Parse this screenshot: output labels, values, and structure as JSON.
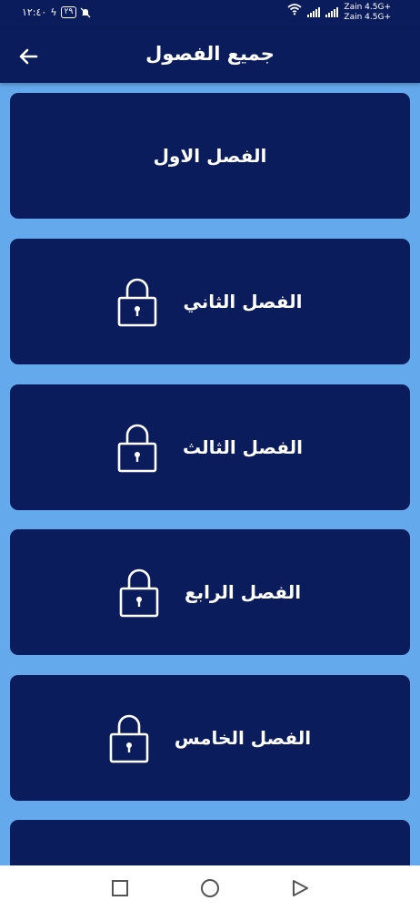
{
  "status_bar": {
    "time": "١٢:٤٠",
    "battery": "٢٩",
    "carrier_1": "Zain 4.5G+",
    "carrier_2": "Zain 4.5G+"
  },
  "app_bar": {
    "title": "جميع الفصول",
    "back_icon": "arrow-left-icon"
  },
  "chapters": [
    {
      "label": "الفصل الاول",
      "locked": false
    },
    {
      "label": "الفصل الثاني",
      "locked": true
    },
    {
      "label": "الفصل الثالث",
      "locked": true
    },
    {
      "label": "الفصل الرابع",
      "locked": true
    },
    {
      "label": "الفصل الخامس",
      "locked": true
    },
    {
      "label": "",
      "locked": true
    }
  ],
  "nav_bar": {
    "icons": [
      "recents-square-icon",
      "home-circle-icon",
      "back-triangle-icon"
    ]
  },
  "colors": {
    "background": "#64a9eb",
    "card": "#0b1c5c",
    "text": "#ffffff"
  }
}
